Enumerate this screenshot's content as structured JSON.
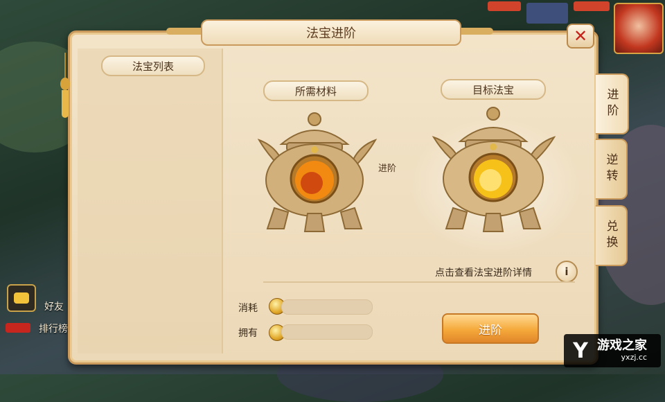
{
  "window": {
    "title": "法宝进阶"
  },
  "left_panel": {
    "header": "法宝列表"
  },
  "materials": {
    "header": "所需材料"
  },
  "target": {
    "header": "目标法宝"
  },
  "arrow_label": "进阶",
  "tabs": [
    {
      "label": "进阶",
      "active": true
    },
    {
      "label": "逆转",
      "active": false
    },
    {
      "label": "兑换",
      "active": false
    }
  ],
  "detail_link": "点击查看法宝进阶详情",
  "info_icon": "i",
  "resources": {
    "consume_label": "消耗",
    "own_label": "拥有"
  },
  "advance_button": "进阶",
  "background_hud": {
    "friend_label": "好友",
    "rank_label": "排行榜"
  },
  "watermark": {
    "logo": "Y",
    "name": "游戏之家",
    "url": "yxzj.cc"
  },
  "colors": {
    "accent": "#f5a93a",
    "close": "#c4221b",
    "panel": "#f3e4c9"
  },
  "icons": [
    "close-icon",
    "info-icon",
    "coin-icon",
    "chat-icon",
    "tassel-icon"
  ]
}
